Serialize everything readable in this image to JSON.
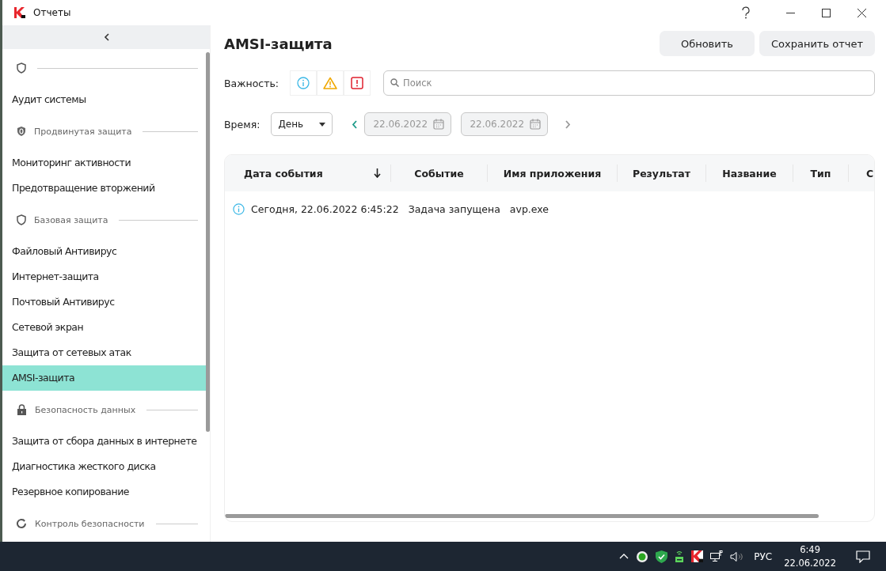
{
  "window": {
    "title": "Отчеты"
  },
  "sidebar": {
    "groups": [
      {
        "items": [
          {
            "label": "Аудит системы",
            "selected": false
          }
        ]
      },
      {
        "label": "Продвинутая защита",
        "items": [
          {
            "label": "Мониторинг активности",
            "selected": false
          },
          {
            "label": "Предотвращение вторжений",
            "selected": false
          }
        ]
      },
      {
        "label": "Базовая защита",
        "items": [
          {
            "label": "Файловый Антивирус",
            "selected": false
          },
          {
            "label": "Интернет-защита",
            "selected": false
          },
          {
            "label": "Почтовый Антивирус",
            "selected": false
          },
          {
            "label": "Сетевой экран",
            "selected": false
          },
          {
            "label": "Защита от сетевых атак",
            "selected": false
          },
          {
            "label": "AMSI-защита",
            "selected": true
          }
        ]
      },
      {
        "label": "Безопасность данных",
        "items": [
          {
            "label": "Защита от сбора данных в интернете",
            "selected": false
          },
          {
            "label": "Диагностика жесткого диска",
            "selected": false
          },
          {
            "label": "Резервное копирование",
            "selected": false
          }
        ]
      },
      {
        "label": "Контроль безопасности"
      }
    ]
  },
  "page": {
    "title": "AMSI-защита",
    "buttons": [
      "Обновить",
      "Сохранить отчет"
    ]
  },
  "filters": {
    "severity_label": "Важность:",
    "severity": [
      {
        "kind": "info"
      },
      {
        "kind": "warning"
      },
      {
        "kind": "error"
      }
    ],
    "search": {
      "placeholder": "Поиск"
    },
    "time_label": "Время:",
    "period": "День",
    "prev": {
      "disabled": false
    },
    "date_from": "22.06.2022",
    "date_to": "22.06.2022",
    "next": {
      "disabled": true
    }
  },
  "table": {
    "columns": [
      {
        "label": "Дата события",
        "sorted": true
      },
      {
        "label": "Событие",
        "sorted": false
      },
      {
        "label": "Имя приложения",
        "sorted": false
      },
      {
        "label": "Результат",
        "sorted": false
      },
      {
        "label": "Название",
        "sorted": false
      },
      {
        "label": "Тип",
        "sorted": false
      },
      {
        "label": "С",
        "sorted": false
      }
    ],
    "rows": [
      {
        "kind": "info",
        "cells": [
          "Сегодня, 22.06.2022 6:45:22",
          "Задача запущена",
          "avp.exe"
        ]
      }
    ]
  },
  "taskbar": {
    "language": "РУС",
    "time": "6:49",
    "date": "22.06.2022"
  }
}
